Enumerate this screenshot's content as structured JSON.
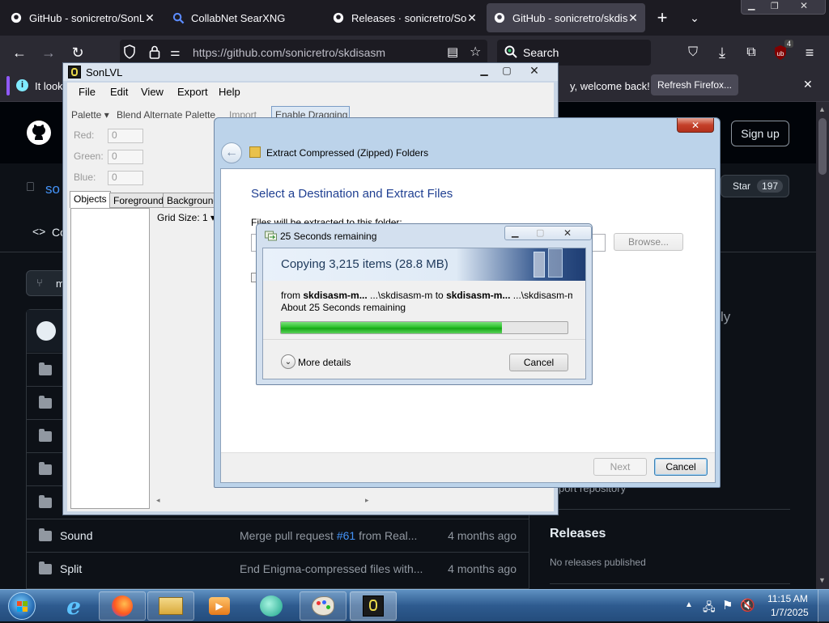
{
  "browser": {
    "tabs": [
      {
        "title": "GitHub - sonicretro/SonLV",
        "active": false
      },
      {
        "title": "CollabNet SearXNG",
        "active": false
      },
      {
        "title": "Releases · sonicretro/SonLV",
        "active": false
      },
      {
        "title": "GitHub - sonicretro/skdisa",
        "active": true
      }
    ],
    "url": "https://github.com/sonicretro/skdisasm",
    "search_placeholder": "Search",
    "badge_count": "4",
    "notification": {
      "prefix": "It look",
      "suffix": "y, welcome back!",
      "button": "Refresh Firefox..."
    }
  },
  "github": {
    "signup": "Sign up",
    "repo_fragment": "so",
    "star_label": "Star",
    "star_count": "197",
    "nav_fragment": "Co",
    "branch_fragment": "m",
    "side_text_fragment": "ly",
    "side_footer_fragment": "port repository",
    "files": [
      {
        "name": "Sound",
        "message_prefix": "Merge pull request ",
        "message_link": "#61",
        "message_suffix": " from Real...",
        "time": "4 months ago"
      },
      {
        "name": "Split",
        "message_prefix": "End Enigma-compressed files with...",
        "message_link": "",
        "message_suffix": "",
        "time": "4 months ago"
      }
    ],
    "releases": {
      "title": "Releases",
      "subtitle": "No releases published"
    }
  },
  "sonlvl": {
    "title": "SonLVL",
    "menu": [
      "File",
      "Edit",
      "View",
      "Export",
      "Help"
    ],
    "toolbar": {
      "palette": "Palette",
      "blend": "Blend Alternate Palette",
      "import": "Import",
      "enable_dragging": "Enable Dragging"
    },
    "color_fields": [
      {
        "label": "Red:",
        "value": "0"
      },
      {
        "label": "Green:",
        "value": "0"
      },
      {
        "label": "Blue:",
        "value": "0"
      }
    ],
    "tabs": [
      "Objects",
      "Foreground",
      "Background"
    ],
    "grid_size": "Grid Size: 1"
  },
  "wizard": {
    "title": "Extract Compressed (Zipped) Folders",
    "heading": "Select a Destination and Extract Files",
    "dest_label": "Files will be extracted to this folder:",
    "browse": "Browse...",
    "next": "Next",
    "cancel": "Cancel"
  },
  "copy_dialog": {
    "title": "25 Seconds remaining",
    "heading": "Copying 3,215 items (28.8 MB)",
    "from_label": "from ",
    "from_name": "skdisasm-m...",
    "from_path": " ...\\skdisasm-m",
    "to_label": " to ",
    "to_name": "skdisasm-m...",
    "to_path": " ...\\skdisasm-m",
    "remaining": "About 25 Seconds remaining",
    "progress_percent": 77,
    "more_details": "More details",
    "cancel": "Cancel"
  },
  "taskbar": {
    "time": "11:15 AM",
    "date": "1/7/2025"
  },
  "colors": {
    "accent_blue": "#0066cc",
    "progress_green": "#16a816",
    "github_bg": "#0d1117",
    "firefox_toolbar": "#2b2a33"
  }
}
